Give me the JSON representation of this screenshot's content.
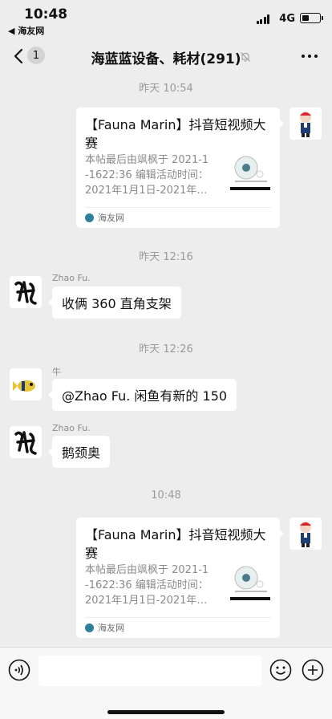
{
  "status_bar": {
    "time": "10:48",
    "back_app": "◀ 海友网",
    "network": "4G"
  },
  "nav": {
    "unread_count": "1",
    "title": "海蓝蓝设备、耗材(291)"
  },
  "messages": {
    "ts1": "昨天 10:54",
    "card1": {
      "title": "【Fauna Marin】抖音短视频大赛",
      "desc": [
        "本帖最后由飒枫于 2021-1",
        "-1622:36 编辑活动时间：",
        "2021年1月1日-2021年…"
      ],
      "source": "海友网"
    },
    "ts2": "昨天 12:16",
    "m1": {
      "sender": "Zhao Fu.",
      "text": "收俩 360 直角支架"
    },
    "ts3": "昨天 12:26",
    "m2": {
      "sender": "牛",
      "text": "@Zhao Fu. 闲鱼有新的 150"
    },
    "m3": {
      "sender": "Zhao Fu.",
      "text": "鹅颈奥"
    },
    "ts4": "10:48",
    "card2": {
      "title": "【Fauna Marin】抖音短视频大赛",
      "desc": [
        "本帖最后由飒枫于 2021-1",
        "-1622:36 编辑活动时间：",
        "2021年1月1日-2021年…"
      ],
      "source": "海友网"
    }
  },
  "input": {
    "placeholder": "",
    "value": ""
  },
  "colors": {
    "background": "#ededed",
    "bubble": "#ffffff",
    "timestamp": "#9a9a9a"
  }
}
